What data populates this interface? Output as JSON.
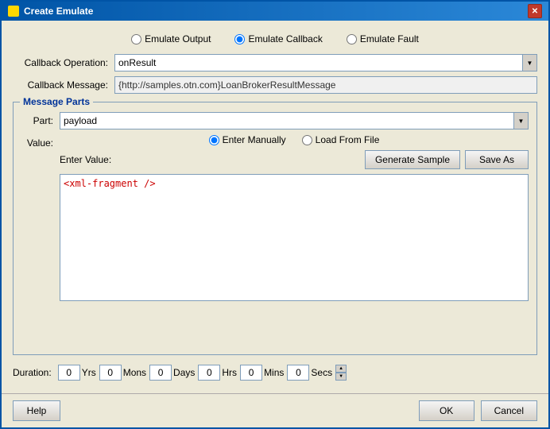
{
  "window": {
    "title": "Create Emulate"
  },
  "mode_radios": {
    "options": [
      "Emulate Output",
      "Emulate Callback",
      "Emulate Fault"
    ],
    "selected": "Emulate Callback"
  },
  "callback_operation": {
    "label": "Callback Operation:",
    "value": "onResult"
  },
  "callback_message": {
    "label": "Callback Message:",
    "value": "{http://samples.otn.com}LoanBrokerResultMessage"
  },
  "message_parts": {
    "group_title": "Message Parts",
    "part_label": "Part:",
    "part_value": "payload",
    "value_label": "Value:",
    "input_mode_options": [
      "Enter Manually",
      "Load From File"
    ],
    "input_mode_selected": "Enter Manually",
    "enter_value_label": "Enter Value:",
    "generate_sample_btn": "Generate Sample",
    "save_as_btn": "Save As",
    "code_content": "<xml-fragment />"
  },
  "duration": {
    "label": "Duration:",
    "fields": [
      {
        "value": "0",
        "unit": "Yrs"
      },
      {
        "value": "0",
        "unit": "Mons"
      },
      {
        "value": "0",
        "unit": "Days"
      },
      {
        "value": "0",
        "unit": "Hrs"
      },
      {
        "value": "0",
        "unit": "Mins"
      },
      {
        "value": "0",
        "unit": "Secs"
      }
    ]
  },
  "buttons": {
    "help": "Help",
    "ok": "OK",
    "cancel": "Cancel"
  }
}
